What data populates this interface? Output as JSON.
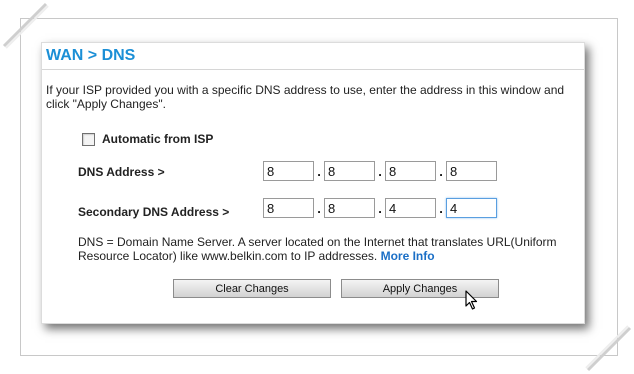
{
  "title": "WAN > DNS",
  "intro": "If your ISP provided you with a specific DNS address to use, enter the address in this window and click \"Apply Changes\".",
  "automatic": {
    "label": "Automatic from ISP",
    "checked": false
  },
  "dns_address": {
    "label": "DNS Address >",
    "octets": [
      "8",
      "8",
      "8",
      "8"
    ]
  },
  "secondary_dns_address": {
    "label": "Secondary DNS Address >",
    "octets": [
      "8",
      "8",
      "4",
      "4"
    ]
  },
  "description": {
    "text": "DNS = Domain Name Server. A server located on the Internet that translates URL(Uniform Resource Locator) like www.belkin.com to IP addresses.",
    "link_label": "More Info"
  },
  "buttons": {
    "clear": "Clear Changes",
    "apply": "Apply Changes"
  },
  "colors": {
    "title": "#1b8fd6",
    "link": "#1b6fc6"
  },
  "icons": {
    "cursor": "mouse-pointer-icon"
  }
}
